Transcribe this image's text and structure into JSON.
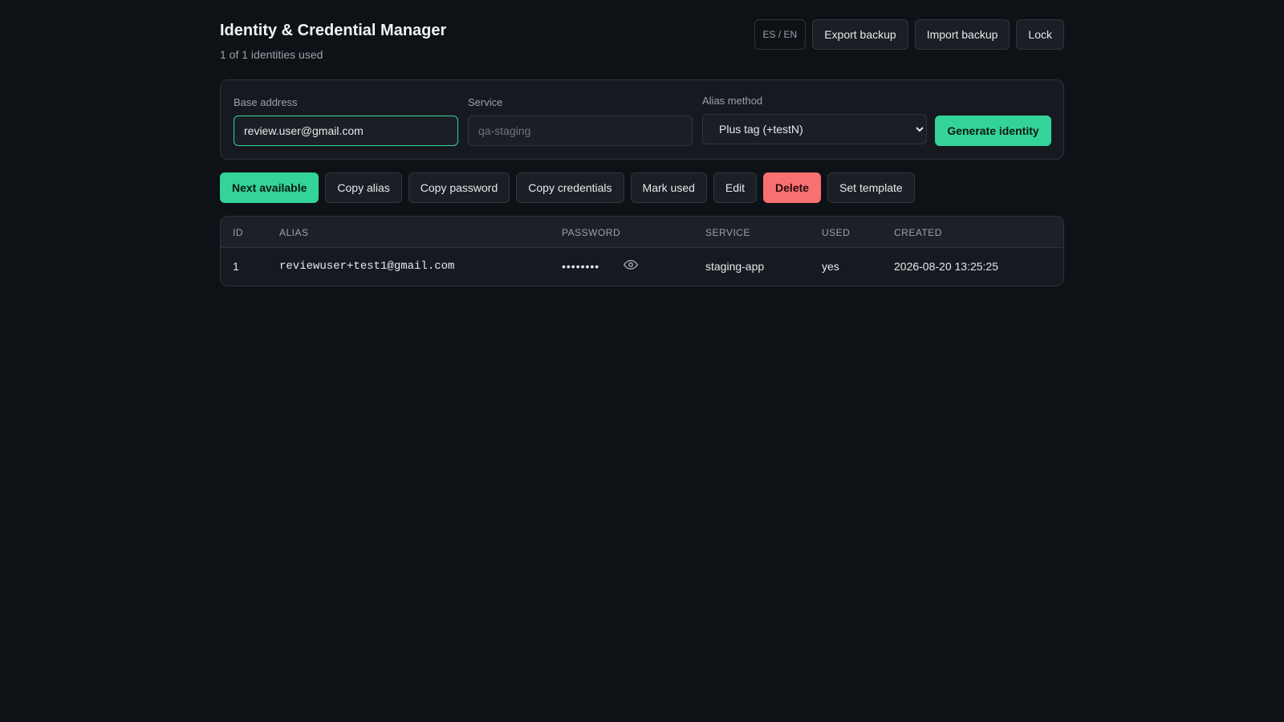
{
  "header": {
    "title": "Identity & Credential Manager",
    "subtitle": "1 of 1 identities used",
    "lang_toggle": "ES / EN",
    "export_label": "Export backup",
    "import_label": "Import backup",
    "lock_label": "Lock"
  },
  "form": {
    "base_address": {
      "label": "Base address",
      "value": "review.user@gmail.com"
    },
    "service": {
      "label": "Service",
      "placeholder": "qa-staging",
      "value": ""
    },
    "alias_method": {
      "label": "Alias method",
      "selected": "Plus tag (+testN)"
    },
    "generate_label": "Generate identity"
  },
  "actions": {
    "next_available": "Next available",
    "copy_alias": "Copy alias",
    "copy_password": "Copy password",
    "copy_credentials": "Copy credentials",
    "mark_used": "Mark used",
    "edit": "Edit",
    "delete": "Delete",
    "set_template": "Set template"
  },
  "table": {
    "columns": [
      "ID",
      "ALIAS",
      "PASSWORD",
      "SERVICE",
      "USED",
      "CREATED"
    ],
    "rows": [
      {
        "id": "1",
        "alias": "reviewuser+test1@gmail.com",
        "password": "••••••••",
        "password_icon": "eye-icon",
        "service": "staging-app",
        "used": "yes",
        "created": "2026-08-20 13:25:25"
      }
    ]
  },
  "colors": {
    "background": "#0e1116",
    "accent": "#34d399",
    "danger": "#f87171"
  }
}
